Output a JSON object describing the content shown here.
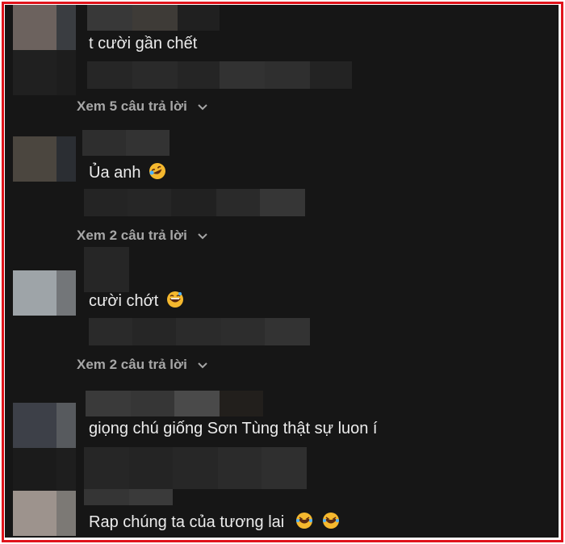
{
  "comments": [
    {
      "text": "t cười gần chết",
      "replies": "Xem 5 câu trả lời"
    },
    {
      "text": "Ủa anh",
      "emoji": "rofl-emoji",
      "replies": "Xem 2 câu trả lời"
    },
    {
      "text": "cười chớt",
      "emoji": "grin-sweat-emoji",
      "replies": "Xem 2 câu trả lời"
    },
    {
      "text": "giọng chú giống Sơn Tùng thật sự luon í"
    },
    {
      "text": "Rap chúng ta của tương lai",
      "emoji": "laughing-emoji"
    }
  ],
  "colors": {
    "background": "#161616",
    "frame": "#e0141c",
    "text": "#ececec",
    "replies": "#a7a7a7"
  }
}
